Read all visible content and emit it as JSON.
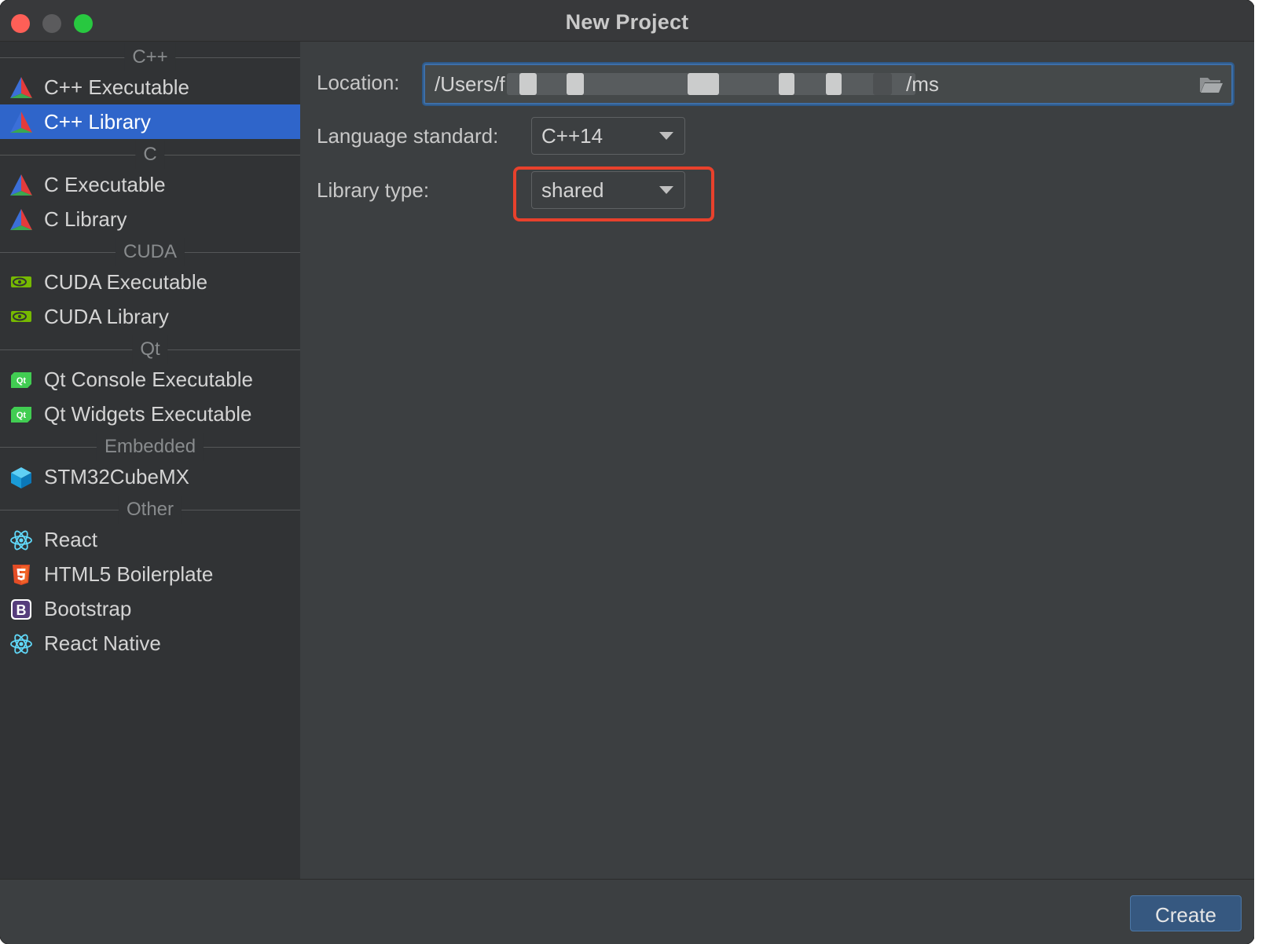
{
  "window": {
    "title": "New Project"
  },
  "sidebar": {
    "groups": [
      {
        "header": "C++",
        "items": [
          {
            "label": "C++ Executable",
            "icon": "cmake-icon"
          },
          {
            "label": "C++ Library",
            "icon": "cmake-icon",
            "selected": true
          }
        ]
      },
      {
        "header": "C",
        "items": [
          {
            "label": "C Executable",
            "icon": "cmake-icon"
          },
          {
            "label": "C Library",
            "icon": "cmake-icon"
          }
        ]
      },
      {
        "header": "CUDA",
        "items": [
          {
            "label": "CUDA Executable",
            "icon": "nvidia-icon"
          },
          {
            "label": "CUDA Library",
            "icon": "nvidia-icon"
          }
        ]
      },
      {
        "header": "Qt",
        "items": [
          {
            "label": "Qt Console Executable",
            "icon": "qt-icon"
          },
          {
            "label": "Qt Widgets Executable",
            "icon": "qt-icon"
          }
        ]
      },
      {
        "header": "Embedded",
        "items": [
          {
            "label": "STM32CubeMX",
            "icon": "stm32cube-icon"
          }
        ]
      },
      {
        "header": "Other",
        "items": [
          {
            "label": "React",
            "icon": "react-icon"
          },
          {
            "label": "HTML5 Boilerplate",
            "icon": "html5-icon"
          },
          {
            "label": "Bootstrap",
            "icon": "bootstrap-icon"
          },
          {
            "label": "React Native",
            "icon": "react-icon"
          }
        ]
      }
    ]
  },
  "form": {
    "location_label": "Location:",
    "location_visible_start": "/Users/f",
    "location_visible_end": "/ms",
    "language_label": "Language standard:",
    "language_value": "C++14",
    "library_type_label": "Library type:",
    "library_type_value": "shared"
  },
  "footer": {
    "create_label": "Create"
  },
  "colors": {
    "selection": "#2f65ca",
    "highlight_annotation": "#e8412c",
    "create_button": "#365880"
  }
}
